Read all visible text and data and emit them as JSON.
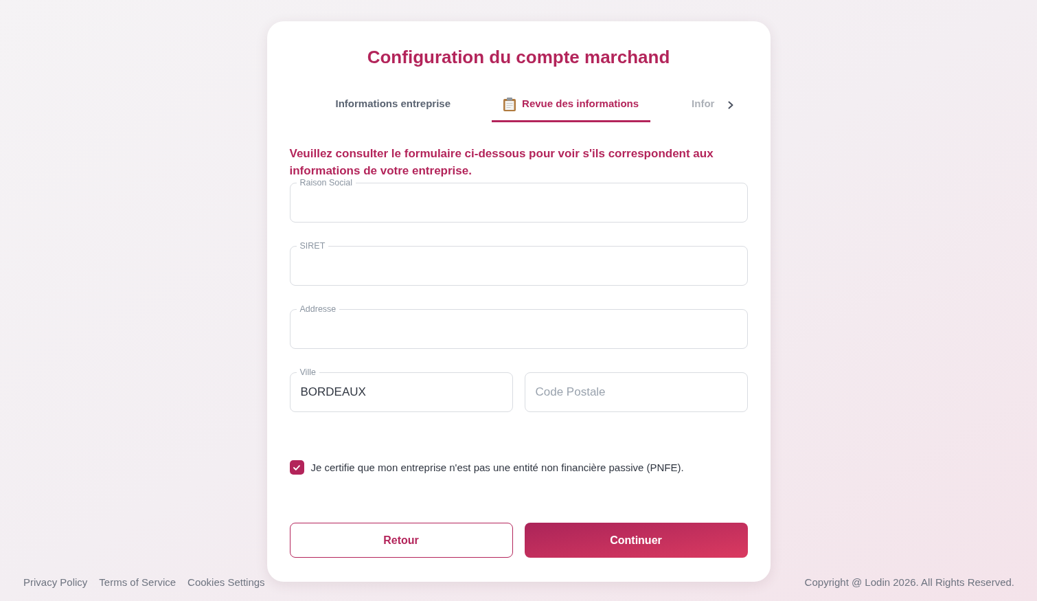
{
  "title": "Configuration du compte marchand",
  "tabs": [
    {
      "label": "Informations entreprise",
      "selected": false,
      "disabled": false
    },
    {
      "label": "Revue des informations",
      "selected": true,
      "disabled": false
    },
    {
      "label": "Infor",
      "selected": false,
      "disabled": true
    }
  ],
  "instructions": "Veuillez consulter le formulaire ci-dessous pour voir s'ils correspondent aux informations de votre entreprise.",
  "field_rows": [
    [
      {
        "label": "Raison Social"
      }
    ],
    [
      {
        "label": "SIRET"
      }
    ],
    [
      {
        "label": "Addresse"
      }
    ],
    [
      {
        "label": "Ville",
        "value": "BORDEAUX"
      },
      {
        "placeholder": "Code Postale"
      }
    ]
  ],
  "certification": {
    "label": "Je certifie que mon entreprise n'est pas une entité non financière passive (PNFE).",
    "checked": true
  },
  "buttons": [
    {
      "label": "Retour",
      "kind": "secondary"
    },
    {
      "label": "Continuer",
      "kind": "primary"
    }
  ],
  "footer": {
    "links": [
      "Privacy Policy",
      "Terms of Service",
      "Cookies Settings"
    ],
    "copyright": "Copyright @ Lodin 2026. All Rights Reserved."
  }
}
